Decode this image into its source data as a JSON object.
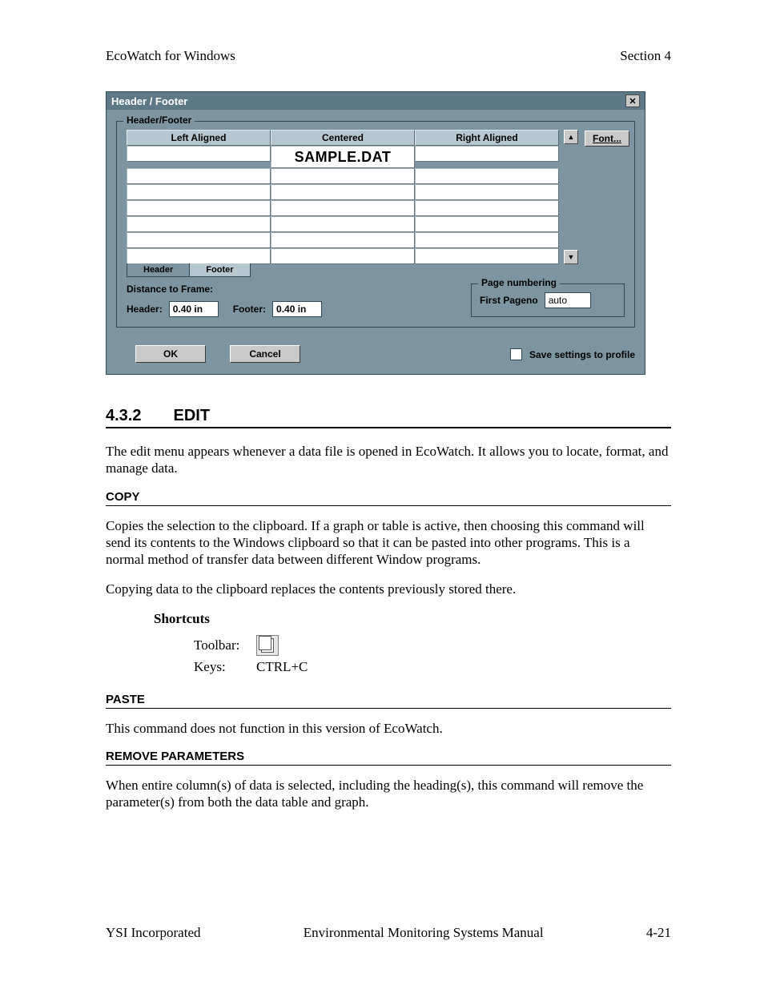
{
  "runhead": {
    "left": "EcoWatch for Windows",
    "right": "Section 4"
  },
  "dialog": {
    "title": "Header / Footer",
    "group_legend": "Header/Footer",
    "col_headers": [
      "Left Aligned",
      "Centered",
      "Right Aligned"
    ],
    "sample_text": "SAMPLE.DAT",
    "tab_header": "Header",
    "tab_footer": "Footer",
    "font_btn": "Font...",
    "distance_label": "Distance to Frame:",
    "header_label": "Header:",
    "header_val": "0.40 in",
    "footer_label": "Footer:",
    "footer_val": "0.40 in",
    "page_num_legend": "Page numbering",
    "first_pageno_label": "First Pageno",
    "first_pageno_val": "auto",
    "ok": "OK",
    "cancel": "Cancel",
    "save_settings": "Save settings to profile"
  },
  "section": {
    "num": "4.3.2",
    "title": "EDIT"
  },
  "intro": "The edit menu appears whenever a data file is opened in EcoWatch. It allows you to locate, format, and manage data.",
  "copy": {
    "heading": "COPY",
    "p1": "Copies the selection to the clipboard. If a graph or table is active, then choosing this command will send its contents to the Windows clipboard so that it can be pasted into other programs. This is a normal method of transfer data between different Window programs.",
    "p2": "Copying data to the clipboard replaces the contents previously stored there.",
    "shortcuts_title": "Shortcuts",
    "toolbar_label": "Toolbar:",
    "keys_label": "Keys:",
    "keys_value": "CTRL+C"
  },
  "paste": {
    "heading": "PASTE",
    "p1": "This command does not function in this version of EcoWatch."
  },
  "remove": {
    "heading": "REMOVE PARAMETERS",
    "p1": "When entire column(s) of data is selected, including the heading(s), this command will remove the parameter(s) from both the data table and graph."
  },
  "footer": {
    "left": "YSI Incorporated",
    "center": "Environmental Monitoring Systems Manual",
    "right": "4-21"
  }
}
